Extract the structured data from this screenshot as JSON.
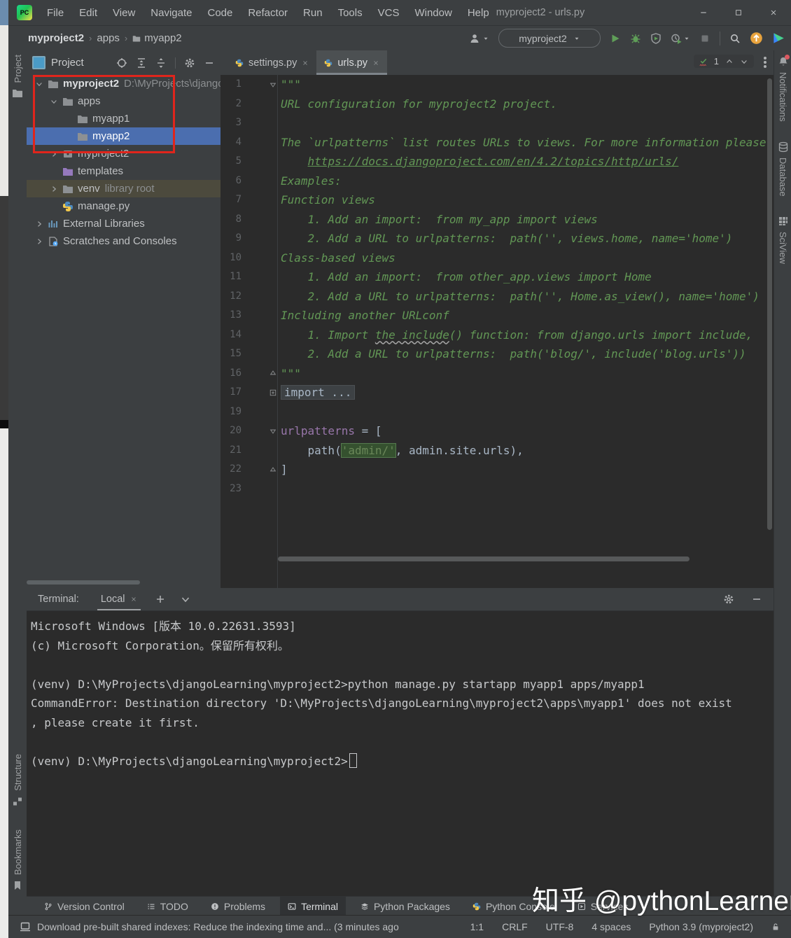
{
  "colors": {
    "panel_bg": "#3c3f41",
    "editor_bg": "#2b2b2b",
    "selection_blue": "#4b6eaf",
    "annotation_red": "#e0251c",
    "comment_green": "#629755",
    "string_green": "#6a8759",
    "variable_purple": "#9876aa",
    "run_green": "#499c54",
    "update_orange": "#e8a33d"
  },
  "window": {
    "title": "myproject2 - urls.py",
    "logo_text": "PC"
  },
  "menu": {
    "items": [
      "File",
      "Edit",
      "View",
      "Navigate",
      "Code",
      "Refactor",
      "Run",
      "Tools",
      "VCS",
      "Window",
      "Help"
    ]
  },
  "breadcrumbs": {
    "items": [
      {
        "label": "myproject2",
        "icon": null
      },
      {
        "label": "apps",
        "icon": null
      },
      {
        "label": "myapp2",
        "icon": "folder"
      }
    ]
  },
  "toolbar": {
    "run_config": "myproject2"
  },
  "left_stripe": {
    "top": [
      {
        "label": "Project",
        "icon": "folder"
      }
    ],
    "bottom": [
      {
        "label": "Structure",
        "icon": "structure"
      },
      {
        "label": "Bookmarks",
        "icon": "bookmark"
      }
    ]
  },
  "right_stripe": [
    {
      "label": "Notifications",
      "icon": "bell",
      "badge": true
    },
    {
      "label": "Database",
      "icon": "database",
      "badge": false
    },
    {
      "label": "SciView",
      "icon": "grid",
      "badge": false
    }
  ],
  "project_panel": {
    "title": "Project",
    "tree": [
      {
        "label": "myproject2",
        "suffix": "D:\\MyProjects\\djangoLe",
        "icon": "folder",
        "depth": 0,
        "chevron": "down",
        "bold": true
      },
      {
        "label": "apps",
        "suffix": "",
        "icon": "folder",
        "depth": 1,
        "chevron": "down"
      },
      {
        "label": "myapp1",
        "suffix": "",
        "icon": "folder",
        "depth": 2,
        "chevron": null
      },
      {
        "label": "myapp2",
        "suffix": "",
        "icon": "folder",
        "depth": 2,
        "chevron": null,
        "selected": true
      },
      {
        "label": "myproject2",
        "suffix": "",
        "icon": "package",
        "depth": 1,
        "chevron": "right"
      },
      {
        "label": "templates",
        "suffix": "",
        "icon": "folder-purple",
        "depth": 1,
        "chevron": null
      },
      {
        "label": "venv",
        "suffix": "library root",
        "icon": "folder",
        "depth": 1,
        "chevron": "right",
        "highlight": "olive"
      },
      {
        "label": "manage.py",
        "suffix": "",
        "icon": "python-file",
        "depth": 1,
        "chevron": null
      },
      {
        "label": "External Libraries",
        "suffix": "",
        "icon": "libraries",
        "depth": 0,
        "chevron": "right"
      },
      {
        "label": "Scratches and Consoles",
        "suffix": "",
        "icon": "scratches",
        "depth": 0,
        "chevron": "right"
      }
    ]
  },
  "editor": {
    "tabs": [
      {
        "label": "settings.py",
        "active": false
      },
      {
        "label": "urls.py",
        "active": true
      }
    ],
    "inspections": {
      "count": "1"
    },
    "lines": [
      {
        "n": "1",
        "fold": "down",
        "parts": [
          {
            "t": "\"\"\"",
            "c": "cm"
          }
        ]
      },
      {
        "n": "2",
        "fold": null,
        "parts": [
          {
            "t": "URL configuration for myproject2 project.",
            "c": "cm"
          }
        ]
      },
      {
        "n": "3",
        "fold": null,
        "parts": []
      },
      {
        "n": "4",
        "fold": null,
        "parts": [
          {
            "t": "The `urlpatterns` list routes URLs to views. For more information please see:",
            "c": "cm"
          }
        ]
      },
      {
        "n": "5",
        "fold": null,
        "parts": [
          {
            "t": "    ",
            "c": "cm"
          },
          {
            "t": "https://docs.djangoproject.com/en/4.2/topics/http/urls/",
            "c": "cm lnk"
          }
        ]
      },
      {
        "n": "6",
        "fold": null,
        "parts": [
          {
            "t": "Examples:",
            "c": "cm"
          }
        ]
      },
      {
        "n": "7",
        "fold": null,
        "parts": [
          {
            "t": "Function views",
            "c": "cm"
          }
        ]
      },
      {
        "n": "8",
        "fold": null,
        "parts": [
          {
            "t": "    1. Add an import:  from my_app import views",
            "c": "cm"
          }
        ]
      },
      {
        "n": "9",
        "fold": null,
        "parts": [
          {
            "t": "    2. Add a URL to urlpatterns:  path('', views.home, name='home')",
            "c": "cm"
          }
        ]
      },
      {
        "n": "10",
        "fold": null,
        "parts": [
          {
            "t": "Class-based views",
            "c": "cm"
          }
        ]
      },
      {
        "n": "11",
        "fold": null,
        "parts": [
          {
            "t": "    1. Add an import:  from other_app.views import Home",
            "c": "cm"
          }
        ]
      },
      {
        "n": "12",
        "fold": null,
        "parts": [
          {
            "t": "    2. Add a URL to urlpatterns:  path('', Home.as_view(), name='home')",
            "c": "cm"
          }
        ]
      },
      {
        "n": "13",
        "fold": null,
        "parts": [
          {
            "t": "Including another URLconf",
            "c": "cm"
          }
        ]
      },
      {
        "n": "14",
        "fold": null,
        "parts": [
          {
            "t": "    1. Import ",
            "c": "cm"
          },
          {
            "t": "the include",
            "c": "cm wavy"
          },
          {
            "t": "() function: from django.urls import include,",
            "c": "cm"
          }
        ]
      },
      {
        "n": "15",
        "fold": null,
        "parts": [
          {
            "t": "    2. Add a URL to urlpatterns:  path('blog/', include('blog.urls'))",
            "c": "cm"
          }
        ]
      },
      {
        "n": "16",
        "fold": "up",
        "parts": [
          {
            "t": "\"\"\"",
            "c": "cm"
          }
        ]
      },
      {
        "n": "17",
        "fold": "plus",
        "parts": [
          {
            "t": "import ...",
            "c": "folded"
          }
        ]
      },
      {
        "n": "19",
        "fold": null,
        "parts": []
      },
      {
        "n": "20",
        "fold": "down",
        "parts": [
          {
            "t": "urlpatterns",
            "c": "var"
          },
          {
            "t": " = [",
            "c": "d"
          }
        ]
      },
      {
        "n": "21",
        "fold": null,
        "parts": [
          {
            "t": "    path(",
            "c": "d"
          },
          {
            "t": "'admin/'",
            "c": "str hl"
          },
          {
            "t": ", admin.site.urls),",
            "c": "d"
          }
        ]
      },
      {
        "n": "22",
        "fold": "up",
        "parts": [
          {
            "t": "]",
            "c": "d"
          }
        ]
      },
      {
        "n": "23",
        "fold": null,
        "parts": []
      }
    ]
  },
  "terminal": {
    "label": "Terminal:",
    "tab": "Local",
    "lines": [
      "Microsoft Windows [版本 10.0.22631.3593]",
      "(c) Microsoft Corporation。保留所有权利。",
      "",
      "(venv) D:\\MyProjects\\djangoLearning\\myproject2>python manage.py startapp myapp1 apps/myapp1",
      "CommandError: Destination directory 'D:\\MyProjects\\djangoLearning\\myproject2\\apps\\myapp1' does not exist",
      ", please create it first.",
      "",
      "(venv) D:\\MyProjects\\djangoLearning\\myproject2>"
    ],
    "cursor_line": 7
  },
  "bottom_bar": {
    "items": [
      {
        "label": "Version Control",
        "icon": "branch",
        "active": false
      },
      {
        "label": "TODO",
        "icon": "todo",
        "active": false
      },
      {
        "label": "Problems",
        "icon": "problem",
        "active": false
      },
      {
        "label": "Terminal",
        "icon": "terminal",
        "active": true
      },
      {
        "label": "Python Packages",
        "icon": "layers",
        "active": false
      },
      {
        "label": "Python Console",
        "icon": "python",
        "active": false
      },
      {
        "label": "Services",
        "icon": "services",
        "active": false
      }
    ]
  },
  "status_bar": {
    "message": "Download pre-built shared indexes: Reduce the indexing time and... (3 minutes ago",
    "items": [
      "1:1",
      "CRLF",
      "UTF-8",
      "4 spaces",
      "Python 3.9 (myproject2)"
    ]
  },
  "watermark": "知乎 @pythonLearner"
}
